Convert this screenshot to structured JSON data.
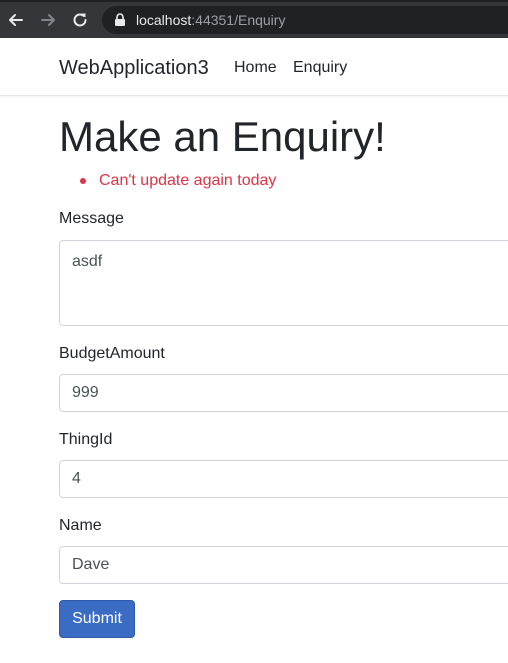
{
  "browser": {
    "url_host": "localhost",
    "url_rest": ":44351/Enquiry"
  },
  "navbar": {
    "brand": "WebApplication3",
    "links": [
      {
        "label": "Home"
      },
      {
        "label": "Enquiry"
      }
    ]
  },
  "page": {
    "title": "Make an Enquiry!",
    "errors": [
      "Can't update again today"
    ]
  },
  "form": {
    "message": {
      "label": "Message",
      "value": "asdf"
    },
    "budget_amount": {
      "label": "BudgetAmount",
      "value": "999"
    },
    "thing_id": {
      "label": "ThingId",
      "value": "4"
    },
    "name": {
      "label": "Name",
      "value": "Dave"
    },
    "submit_label": "Submit"
  },
  "colors": {
    "chrome": "#35363a",
    "error": "#dc3545",
    "primary": "#3a6cc3"
  },
  "icons": [
    "back-arrow-icon",
    "forward-arrow-icon",
    "reload-icon",
    "lock-icon"
  ]
}
